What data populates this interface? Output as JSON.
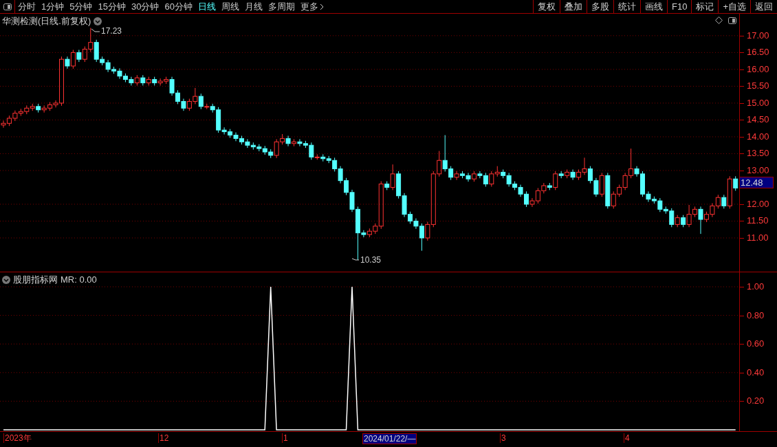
{
  "toolbar": {
    "periods": [
      {
        "label": "分时",
        "selected": false
      },
      {
        "label": "1分钟",
        "selected": false
      },
      {
        "label": "5分钟",
        "selected": false
      },
      {
        "label": "15分钟",
        "selected": false
      },
      {
        "label": "30分钟",
        "selected": false
      },
      {
        "label": "60分钟",
        "selected": false
      },
      {
        "label": "日线",
        "selected": true
      },
      {
        "label": "周线",
        "selected": false
      },
      {
        "label": "月线",
        "selected": false
      },
      {
        "label": "多周期",
        "selected": false
      }
    ],
    "more": "更多",
    "buttons": [
      "复权",
      "叠加",
      "多股",
      "统计",
      "画线",
      "F10",
      "标记",
      "+自选",
      "返回"
    ]
  },
  "main_chart": {
    "title": "华测检测(日线.前复权)",
    "high_label": "17.23",
    "low_label": "10.35",
    "last_price": "12.48",
    "chart_data": {
      "type": "candlestick",
      "ylim": [
        9.98,
        17.65
      ],
      "grid": true,
      "yticks": [
        {
          "value": 17,
          "label": "17.00"
        },
        {
          "value": 16.5,
          "label": "16.50"
        },
        {
          "value": 16,
          "label": "16.00"
        },
        {
          "value": 15.5,
          "label": "15.50"
        },
        {
          "value": 15,
          "label": "15.00"
        },
        {
          "value": 14.5,
          "label": "14.50"
        },
        {
          "value": 14,
          "label": "14.00"
        },
        {
          "value": 13.5,
          "label": "13.50"
        },
        {
          "value": 13,
          "label": "13.00"
        },
        {
          "value": 12,
          "label": "12.00"
        },
        {
          "value": 11.5,
          "label": "11.50"
        },
        {
          "value": 11,
          "label": "11.00"
        }
      ],
      "ohlc": [
        [
          14.35,
          14.48,
          14.27,
          14.4
        ],
        [
          14.4,
          14.63,
          14.32,
          14.55
        ],
        [
          14.55,
          14.78,
          14.47,
          14.7
        ],
        [
          14.7,
          14.83,
          14.62,
          14.75
        ],
        [
          14.75,
          14.93,
          14.67,
          14.85
        ],
        [
          14.85,
          14.98,
          14.77,
          14.9
        ],
        [
          14.9,
          14.98,
          14.72,
          14.8
        ],
        [
          14.8,
          14.93,
          14.72,
          14.85
        ],
        [
          14.85,
          15.03,
          14.77,
          14.95
        ],
        [
          14.95,
          15.08,
          14.87,
          15.0
        ],
        [
          15.0,
          16.38,
          14.92,
          16.3
        ],
        [
          16.3,
          16.38,
          16.02,
          16.1
        ],
        [
          16.1,
          16.58,
          16.02,
          16.5
        ],
        [
          16.5,
          16.58,
          16.22,
          16.3
        ],
        [
          16.3,
          16.68,
          16.22,
          16.6
        ],
        [
          16.6,
          17.23,
          16.52,
          16.8
        ],
        [
          16.8,
          16.88,
          16.22,
          16.3
        ],
        [
          16.3,
          16.38,
          16.12,
          16.2
        ],
        [
          16.2,
          16.28,
          15.92,
          16.0
        ],
        [
          16.0,
          16.08,
          15.87,
          15.95
        ],
        [
          15.95,
          16.03,
          15.72,
          15.8
        ],
        [
          15.8,
          15.88,
          15.62,
          15.7
        ],
        [
          15.7,
          15.78,
          15.52,
          15.6
        ],
        [
          15.6,
          15.83,
          15.52,
          15.75
        ],
        [
          15.75,
          15.83,
          15.52,
          15.6
        ],
        [
          15.6,
          15.78,
          15.52,
          15.7
        ],
        [
          15.7,
          15.78,
          15.52,
          15.6
        ],
        [
          15.6,
          15.73,
          15.52,
          15.65
        ],
        [
          15.65,
          15.78,
          15.57,
          15.7
        ],
        [
          15.7,
          15.78,
          15.22,
          15.3
        ],
        [
          15.3,
          15.38,
          14.97,
          15.05
        ],
        [
          15.05,
          15.13,
          14.77,
          14.85
        ],
        [
          14.85,
          15.13,
          14.77,
          15.05
        ],
        [
          15.05,
          15.45,
          14.97,
          15.2
        ],
        [
          15.2,
          15.28,
          14.82,
          14.9
        ],
        [
          14.9,
          14.98,
          14.82,
          14.9
        ],
        [
          14.9,
          14.98,
          14.72,
          14.8
        ],
        [
          14.8,
          14.88,
          14.12,
          14.2
        ],
        [
          14.2,
          14.28,
          14.07,
          14.15
        ],
        [
          14.15,
          14.23,
          13.97,
          14.05
        ],
        [
          14.05,
          14.13,
          13.87,
          13.95
        ],
        [
          13.95,
          14.03,
          13.77,
          13.85
        ],
        [
          13.85,
          13.93,
          13.67,
          13.75
        ],
        [
          13.75,
          13.83,
          13.62,
          13.7
        ],
        [
          13.7,
          13.78,
          13.57,
          13.65
        ],
        [
          13.65,
          13.73,
          13.47,
          13.55
        ],
        [
          13.55,
          13.63,
          13.37,
          13.45
        ],
        [
          13.45,
          13.93,
          13.37,
          13.85
        ],
        [
          13.85,
          14.08,
          13.77,
          13.95
        ],
        [
          13.95,
          14.03,
          13.72,
          13.8
        ],
        [
          13.8,
          13.93,
          13.72,
          13.85
        ],
        [
          13.85,
          13.93,
          13.72,
          13.8
        ],
        [
          13.8,
          13.88,
          13.67,
          13.75
        ],
        [
          13.75,
          13.83,
          13.32,
          13.4
        ],
        [
          13.4,
          13.48,
          13.32,
          13.4
        ],
        [
          13.4,
          13.48,
          13.27,
          13.35
        ],
        [
          13.35,
          13.43,
          13.22,
          13.3
        ],
        [
          13.3,
          13.38,
          12.97,
          13.05
        ],
        [
          13.05,
          13.13,
          12.62,
          12.7
        ],
        [
          12.7,
          12.78,
          12.27,
          12.35
        ],
        [
          12.35,
          12.43,
          11.77,
          11.85
        ],
        [
          11.85,
          11.93,
          10.35,
          11.15
        ],
        [
          11.15,
          11.23,
          11.02,
          11.1
        ],
        [
          11.1,
          11.28,
          11.02,
          11.2
        ],
        [
          11.2,
          11.43,
          11.12,
          11.35
        ],
        [
          11.35,
          12.68,
          11.27,
          12.6
        ],
        [
          12.6,
          12.68,
          12.42,
          12.5
        ],
        [
          12.5,
          13.18,
          12.42,
          12.9
        ],
        [
          12.9,
          12.98,
          12.17,
          12.25
        ],
        [
          12.25,
          12.33,
          11.62,
          11.7
        ],
        [
          11.7,
          11.78,
          11.42,
          11.5
        ],
        [
          11.5,
          11.58,
          11.27,
          11.35
        ],
        [
          11.35,
          11.43,
          10.62,
          11.0
        ],
        [
          11.0,
          11.48,
          10.92,
          11.4
        ],
        [
          11.4,
          12.98,
          11.32,
          12.9
        ],
        [
          12.9,
          13.58,
          12.82,
          13.3
        ],
        [
          13.3,
          14.05,
          12.97,
          13.05
        ],
        [
          13.05,
          13.13,
          12.72,
          12.8
        ],
        [
          12.8,
          12.98,
          12.72,
          12.9
        ],
        [
          12.9,
          12.98,
          12.77,
          12.85
        ],
        [
          12.85,
          12.93,
          12.67,
          12.75
        ],
        [
          12.75,
          12.98,
          12.67,
          12.9
        ],
        [
          12.9,
          12.98,
          12.77,
          12.85
        ],
        [
          12.85,
          12.93,
          12.52,
          12.6
        ],
        [
          12.6,
          12.98,
          12.52,
          12.9
        ],
        [
          12.9,
          13.13,
          12.82,
          12.95
        ],
        [
          12.95,
          13.03,
          12.77,
          12.85
        ],
        [
          12.85,
          12.93,
          12.52,
          12.6
        ],
        [
          12.6,
          12.68,
          12.42,
          12.5
        ],
        [
          12.5,
          12.58,
          12.22,
          12.3
        ],
        [
          12.3,
          12.38,
          11.92,
          12.0
        ],
        [
          12.0,
          12.18,
          11.92,
          12.1
        ],
        [
          12.1,
          12.48,
          12.02,
          12.4
        ],
        [
          12.4,
          12.63,
          12.32,
          12.55
        ],
        [
          12.55,
          12.63,
          12.42,
          12.5
        ],
        [
          12.5,
          12.98,
          12.42,
          12.9
        ],
        [
          12.9,
          12.98,
          12.77,
          12.85
        ],
        [
          12.85,
          13.03,
          12.77,
          12.95
        ],
        [
          12.95,
          13.03,
          12.72,
          12.8
        ],
        [
          12.8,
          13.03,
          12.72,
          12.95
        ],
        [
          12.95,
          13.38,
          12.87,
          13.05
        ],
        [
          13.05,
          13.13,
          12.62,
          12.7
        ],
        [
          12.7,
          12.78,
          12.22,
          12.3
        ],
        [
          12.3,
          12.93,
          12.22,
          12.85
        ],
        [
          12.85,
          12.93,
          11.87,
          11.95
        ],
        [
          11.95,
          12.38,
          11.87,
          12.3
        ],
        [
          12.3,
          12.58,
          12.22,
          12.5
        ],
        [
          12.5,
          12.93,
          12.42,
          12.85
        ],
        [
          12.85,
          13.65,
          12.77,
          13.05
        ],
        [
          13.05,
          13.13,
          12.82,
          12.9
        ],
        [
          12.9,
          12.98,
          12.22,
          12.3
        ],
        [
          12.3,
          12.38,
          12.07,
          12.15
        ],
        [
          12.15,
          12.23,
          12.02,
          12.1
        ],
        [
          12.1,
          12.18,
          11.77,
          11.85
        ],
        [
          11.85,
          11.93,
          11.72,
          11.8
        ],
        [
          11.8,
          11.88,
          11.32,
          11.4
        ],
        [
          11.4,
          11.68,
          11.32,
          11.6
        ],
        [
          11.6,
          11.68,
          11.32,
          11.4
        ],
        [
          11.4,
          11.98,
          11.32,
          11.7
        ],
        [
          11.7,
          11.93,
          11.62,
          11.85
        ],
        [
          11.85,
          11.93,
          11.12,
          11.55
        ],
        [
          11.55,
          11.78,
          11.47,
          11.7
        ],
        [
          11.7,
          12.03,
          11.62,
          11.95
        ],
        [
          11.95,
          12.28,
          11.87,
          12.2
        ],
        [
          12.2,
          12.28,
          11.87,
          11.95
        ],
        [
          11.95,
          12.83,
          11.87,
          12.75
        ],
        [
          12.75,
          12.83,
          12.4,
          12.48
        ]
      ]
    }
  },
  "indicator": {
    "title": "股朋指标网",
    "reading": "MR: 0.00",
    "chart_data": {
      "type": "line",
      "ylim": [
        0,
        1
      ],
      "grid": true,
      "yticks": [
        {
          "value": 1,
          "label": "1.00"
        },
        {
          "value": 0.8,
          "label": "0.80"
        },
        {
          "value": 0.6,
          "label": "0.60"
        },
        {
          "value": 0.4,
          "label": "0.40"
        },
        {
          "value": 0.2,
          "label": "0.20"
        }
      ],
      "series": [
        {
          "color": "#ffffff",
          "values": [
            0,
            0,
            0,
            0,
            0,
            0,
            0,
            0,
            0,
            0,
            0,
            0,
            0,
            0,
            0,
            0,
            0,
            0,
            0,
            0,
            0,
            0,
            0,
            0,
            0,
            0,
            0,
            0,
            0,
            0,
            0,
            0,
            0,
            0,
            0,
            0,
            0,
            0,
            0,
            0,
            0,
            0,
            0,
            0,
            0,
            0,
            1,
            0,
            0,
            0,
            0,
            0,
            0,
            0,
            0,
            0,
            0,
            0,
            0,
            0,
            1,
            0,
            0,
            0,
            0,
            0,
            0,
            0,
            0,
            0,
            0,
            0,
            0,
            0,
            0,
            0,
            0,
            0,
            0,
            0,
            0,
            0,
            0,
            0,
            0,
            0,
            0,
            0,
            0,
            0,
            0,
            0,
            0,
            0,
            0,
            0,
            0,
            0,
            0,
            0,
            0,
            0,
            0,
            0,
            0,
            0,
            0,
            0,
            0,
            0,
            0,
            0,
            0,
            0,
            0,
            0,
            0,
            0,
            0,
            0,
            0,
            0,
            0,
            0,
            0,
            0,
            0
          ]
        }
      ]
    }
  },
  "date_axis": [
    {
      "label": "2023年",
      "highlighted": false
    },
    {
      "label": "12",
      "highlighted": false
    },
    {
      "label": "1",
      "highlighted": false
    },
    {
      "label": "2024/01/22/—",
      "highlighted": true
    },
    {
      "label": "3",
      "highlighted": false
    },
    {
      "label": "4",
      "highlighted": false
    }
  ]
}
